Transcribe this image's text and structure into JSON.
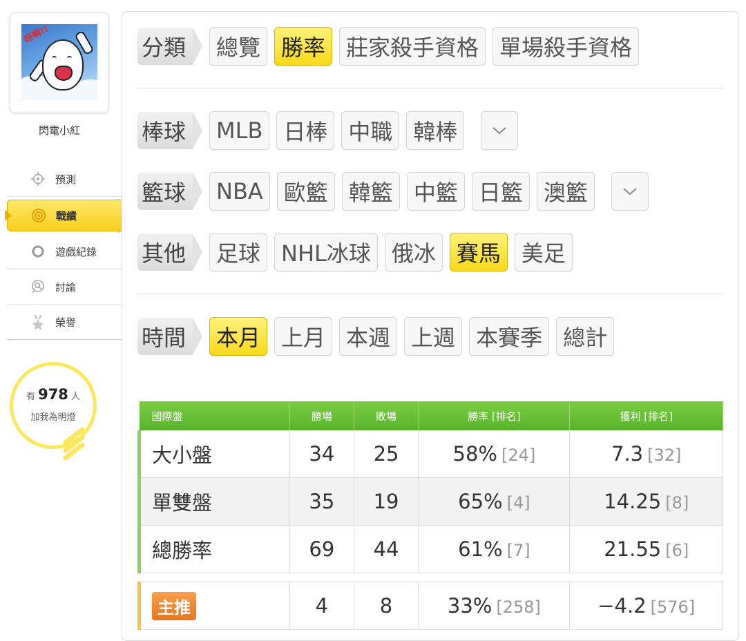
{
  "user": {
    "name": "閃電小紅",
    "avatar_text": "呀啊!!"
  },
  "sidebar": {
    "items": [
      {
        "label": "預測",
        "icon": "crosshair-icon"
      },
      {
        "label": "戰績",
        "icon": "target-icon"
      },
      {
        "label": "遊戲紀錄",
        "icon": "circle-icon"
      },
      {
        "label": "討論",
        "icon": "chat-search-icon"
      },
      {
        "label": "榮譽",
        "icon": "medal-star-icon"
      }
    ]
  },
  "fans": {
    "prefix": "有",
    "count": "978",
    "suffix": "人",
    "caption": "加我為明燈"
  },
  "filters": {
    "category": {
      "label": "分類",
      "options": [
        "總覽",
        "勝率",
        "莊家殺手資格",
        "單場殺手資格"
      ],
      "selected": "勝率"
    },
    "baseball": {
      "label": "棒球",
      "options": [
        "MLB",
        "日棒",
        "中職",
        "韓棒"
      ]
    },
    "basketball": {
      "label": "籃球",
      "options": [
        "NBA",
        "歐籃",
        "韓籃",
        "中籃",
        "日籃",
        "澳籃"
      ]
    },
    "other": {
      "label": "其他",
      "options": [
        "足球",
        "NHL冰球",
        "俄冰",
        "賽馬",
        "美足"
      ],
      "selected": "賽馬"
    },
    "time": {
      "label": "時間",
      "options": [
        "本月",
        "上月",
        "本週",
        "上週",
        "本賽季",
        "總計"
      ],
      "selected": "本月"
    }
  },
  "stats": {
    "headers": [
      "國際盤",
      "勝場",
      "敗場",
      "勝率 [排名]",
      "獲利 [排名]"
    ],
    "rows": [
      {
        "name": "大小盤",
        "wins": "34",
        "losses": "25",
        "rate": "58%",
        "rate_rank": "[24]",
        "profit": "7.3",
        "profit_rank": "[32]"
      },
      {
        "name": "單雙盤",
        "wins": "35",
        "losses": "19",
        "rate": "65%",
        "rate_rank": "[4]",
        "profit": "14.25",
        "profit_rank": "[8]"
      },
      {
        "name": "總勝率",
        "wins": "69",
        "losses": "44",
        "rate": "61%",
        "rate_rank": "[7]",
        "profit": "21.55",
        "profit_rank": "[6]"
      }
    ],
    "featured": {
      "tag": "主推",
      "wins": "4",
      "losses": "8",
      "rate": "33%",
      "rate_rank": "[258]",
      "profit": "−4.2",
      "profit_rank": "[576]"
    }
  },
  "colors": {
    "accent_yellow": "#f8d91a",
    "header_green": "#58b42a",
    "tag_orange": "#e8751c"
  }
}
